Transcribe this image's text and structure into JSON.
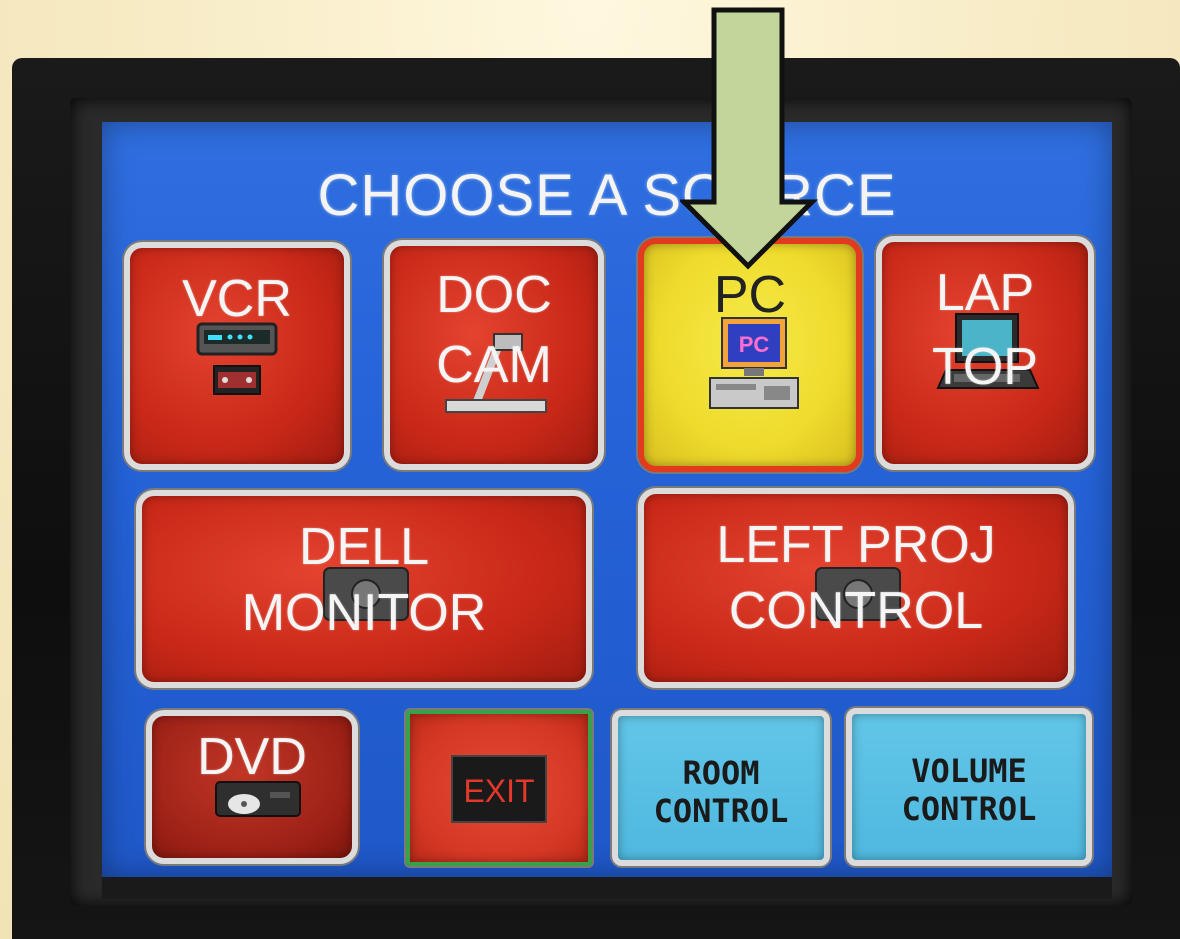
{
  "screen": {
    "title": "CHOOSE A SOURCE"
  },
  "sources": {
    "vcr": {
      "line1": "VCR"
    },
    "doc_cam": {
      "line1": "DOC",
      "line2": "CAM"
    },
    "pc": {
      "line1": "PC",
      "screen_text": "PC"
    },
    "laptop": {
      "line1": "LAP",
      "line2": "TOP"
    }
  },
  "displays": {
    "dell_monitor": {
      "line1": "DELL",
      "line2": "MONITOR"
    },
    "left_proj": {
      "line1": "LEFT PROJ",
      "line2": "CONTROL"
    }
  },
  "bottom": {
    "dvd": {
      "line1": "DVD"
    },
    "exit": {
      "label": "EXIT"
    },
    "room_control": {
      "line1": "ROOM",
      "line2": "CONTROL"
    },
    "volume_control": {
      "line1": "VOLUME",
      "line2": "CONTROL"
    }
  },
  "colors": {
    "screen_blue": "#2563d8",
    "button_red": "#c92818",
    "selected_yellow": "#eedb2c",
    "selected_border": "#e23a1e",
    "cyan_button": "#4fb8df",
    "arrow_fill": "#c3d59a",
    "arrow_stroke": "#111111"
  },
  "icons": {
    "arrow": "down-arrow-icon",
    "vcr": "vcr-icon",
    "doc_cam": "document-camera-icon",
    "pc": "desktop-pc-icon",
    "laptop": "laptop-icon",
    "dvd": "dvd-player-icon",
    "exit": "exit-sign-icon",
    "projector": "projector-icon"
  },
  "selected_source": "pc"
}
